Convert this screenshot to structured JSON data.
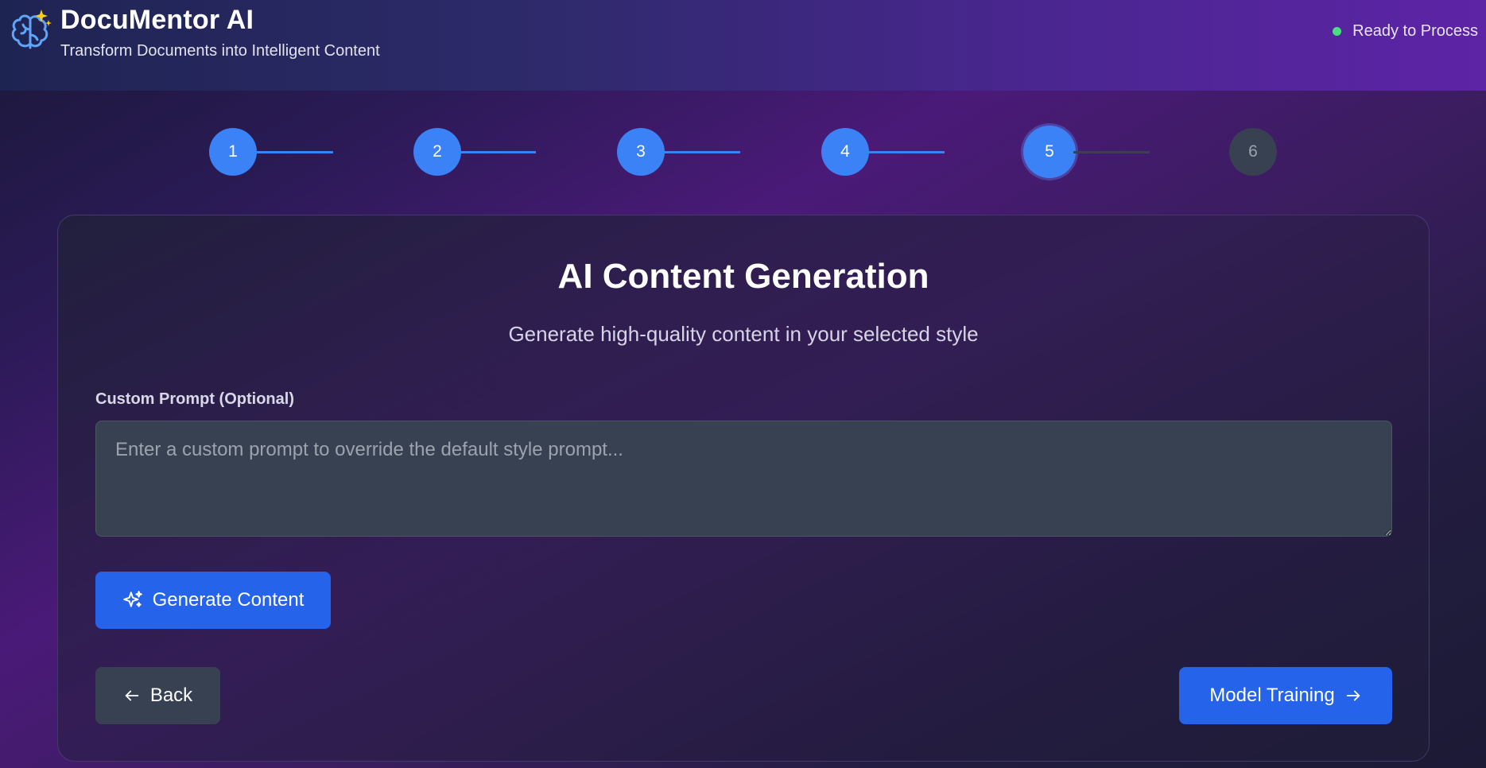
{
  "header": {
    "title": "DocuMentor AI",
    "subtitle": "Transform Documents into Intelligent Content",
    "logo_icon": "brain-sparkle-icon",
    "status_text": "Ready to Process",
    "status_color": "#4ade80"
  },
  "stepper": {
    "steps": [
      {
        "label": "1",
        "state": "complete"
      },
      {
        "label": "2",
        "state": "complete"
      },
      {
        "label": "3",
        "state": "complete"
      },
      {
        "label": "4",
        "state": "complete"
      },
      {
        "label": "5",
        "state": "current"
      },
      {
        "label": "6",
        "state": "pending"
      }
    ],
    "active_color": "#3b82f6",
    "pending_color": "#374151"
  },
  "main": {
    "title": "AI Content Generation",
    "subtitle": "Generate high-quality content in your selected style",
    "prompt": {
      "label": "Custom Prompt (Optional)",
      "placeholder": "Enter a custom prompt to override the default style prompt...",
      "value": ""
    },
    "generate_button": {
      "label": "Generate Content",
      "icon": "sparkles-icon"
    },
    "back_button": {
      "label": "Back",
      "icon": "arrow-left-icon"
    },
    "next_button": {
      "label": "Model Training",
      "icon": "arrow-right-icon"
    }
  }
}
